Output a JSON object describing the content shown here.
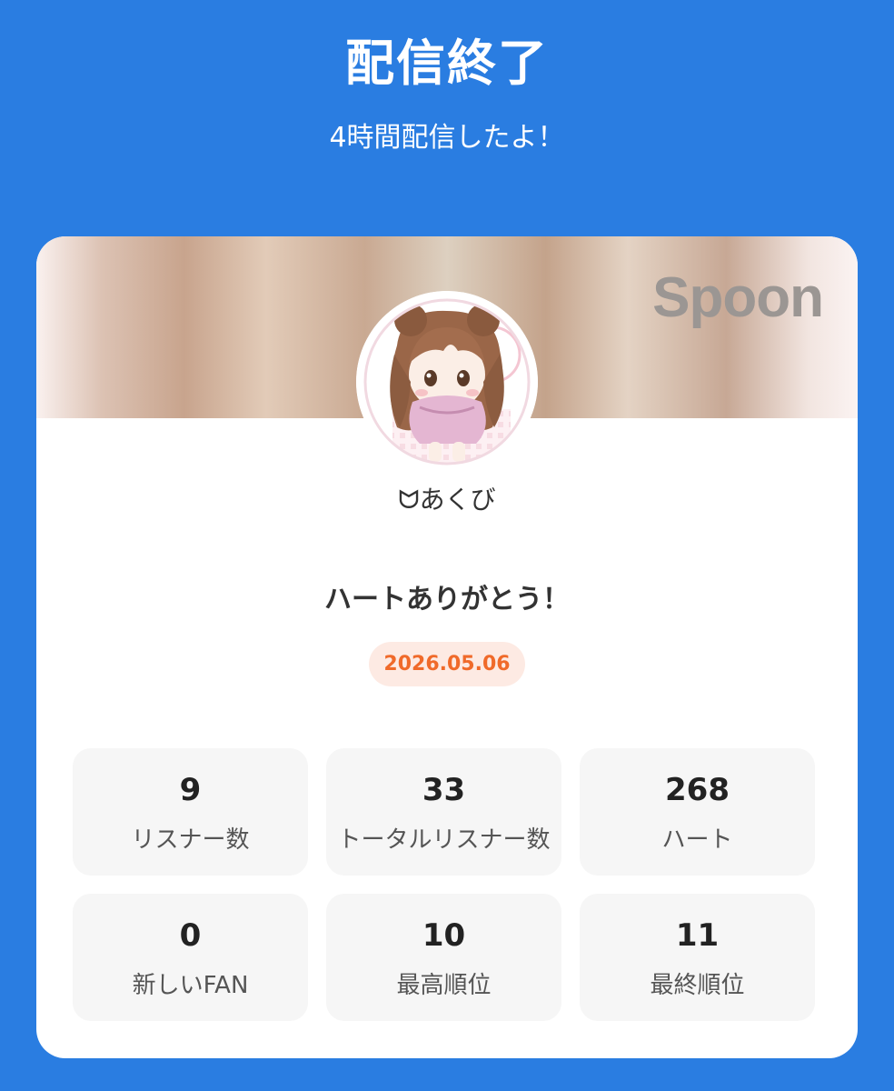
{
  "header": {
    "title": "配信終了",
    "subtitle": "4時間配信したよ！"
  },
  "card": {
    "brand": "Spoon",
    "username": "ᗢあくび",
    "thanks": "ハートありがとう！",
    "date": "2026.05.06",
    "stats": [
      {
        "value": "9",
        "label": "リスナー数"
      },
      {
        "value": "33",
        "label": "トータルリスナー数"
      },
      {
        "value": "268",
        "label": "ハート"
      },
      {
        "value": "0",
        "label": "新しいFAN"
      },
      {
        "value": "10",
        "label": "最高順位"
      },
      {
        "value": "11",
        "label": "最終順位"
      }
    ]
  },
  "colors": {
    "background": "#2a7de1",
    "date_text": "#f06a2a",
    "date_badge": "#fdeae3",
    "stat_tile": "#f6f6f6"
  },
  "icons": {
    "avatar": "profile-avatar-illustration"
  }
}
